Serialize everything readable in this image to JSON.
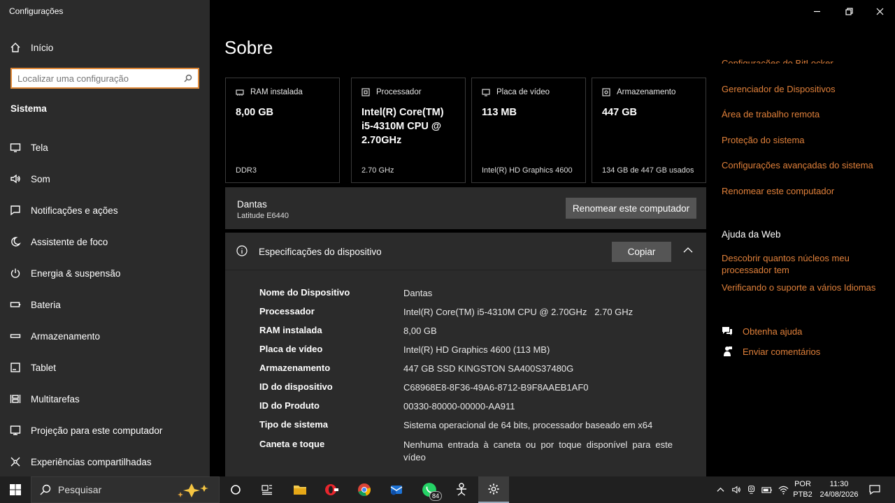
{
  "window": {
    "title": "Configurações"
  },
  "sidebar": {
    "home_label": "Início",
    "search_placeholder": "Localizar uma configuração",
    "section_label": "Sistema",
    "items": [
      {
        "label": "Tela",
        "icon": "display-icon"
      },
      {
        "label": "Som",
        "icon": "speaker-icon"
      },
      {
        "label": "Notificações e ações",
        "icon": "notification-icon"
      },
      {
        "label": "Assistente de foco",
        "icon": "moon-icon"
      },
      {
        "label": "Energia & suspensão",
        "icon": "power-icon"
      },
      {
        "label": "Bateria",
        "icon": "battery-icon"
      },
      {
        "label": "Armazenamento",
        "icon": "storage-icon"
      },
      {
        "label": "Tablet",
        "icon": "tablet-icon"
      },
      {
        "label": "Multitarefas",
        "icon": "multitask-icon"
      },
      {
        "label": "Projeção para este computador",
        "icon": "projection-icon"
      },
      {
        "label": "Experiências compartilhadas",
        "icon": "share-icon"
      }
    ]
  },
  "main": {
    "title": "Sobre",
    "cards": [
      {
        "label": "RAM instalada",
        "value": "8,00 GB",
        "sub": "DDR3",
        "icon": "ram-icon"
      },
      {
        "label": "Processador",
        "value": "Intel(R) Core(TM) i5-4310M CPU @ 2.70GHz",
        "sub": "2.70 GHz",
        "icon": "cpu-icon"
      },
      {
        "label": "Placa de vídeo",
        "value": "113 MB",
        "sub": "Intel(R) HD Graphics 4600",
        "icon": "gpu-icon"
      },
      {
        "label": "Armazenamento",
        "value": "447 GB",
        "sub": "134 GB de 447 GB usados",
        "icon": "disk-icon"
      }
    ],
    "device": {
      "name": "Dantas",
      "model": "Latitude E6440",
      "rename_label": "Renomear este computador"
    },
    "specs": {
      "title": "Especificações do dispositivo",
      "copy_label": "Copiar",
      "rows": [
        {
          "key": "Nome do Dispositivo",
          "value": "Dantas"
        },
        {
          "key": "Processador",
          "value": "Intel(R) Core(TM) i5-4310M CPU @ 2.70GHz   2.70 GHz"
        },
        {
          "key": "RAM instalada",
          "value": "8,00 GB"
        },
        {
          "key": "Placa de vídeo",
          "value": "Intel(R) HD Graphics 4600 (113 MB)"
        },
        {
          "key": "Armazenamento",
          "value": "447 GB SSD KINGSTON SA400S37480G"
        },
        {
          "key": "ID do dispositivo",
          "value": "C68968E8-8F36-49A6-8712-B9F8AAEB1AF0"
        },
        {
          "key": "ID do Produto",
          "value": "00330-80000-00000-AA911"
        },
        {
          "key": "Tipo de sistema",
          "value": "Sistema operacional de 64 bits, processador baseado em x64"
        },
        {
          "key": "Caneta e toque",
          "value": "Nenhuma entrada à caneta ou por toque disponível para este vídeo"
        }
      ]
    }
  },
  "right": {
    "links": [
      "Configurações do BitLocker",
      "Gerenciador de Dispositivos",
      "Área de trabalho remota",
      "Proteção do sistema",
      "Configurações avançadas do sistema",
      "Renomear este computador"
    ],
    "web_help_title": "Ajuda da Web",
    "web_links": [
      "Descobrir quantos núcleos meu processador tem",
      "Verificando o suporte a vários Idiomas"
    ],
    "get_help": "Obtenha ajuda",
    "feedback": "Enviar comentários"
  },
  "taskbar": {
    "search_placeholder": "Pesquisar",
    "whatsapp_badge": "84",
    "lang_top": "POR",
    "lang_bottom": "PTB2",
    "time": "11:30",
    "date": "24/08/2026"
  },
  "colors": {
    "accent": "#e0803a",
    "sidebar_bg": "#2b2b2b",
    "panel_bg": "#2b2b2b"
  }
}
